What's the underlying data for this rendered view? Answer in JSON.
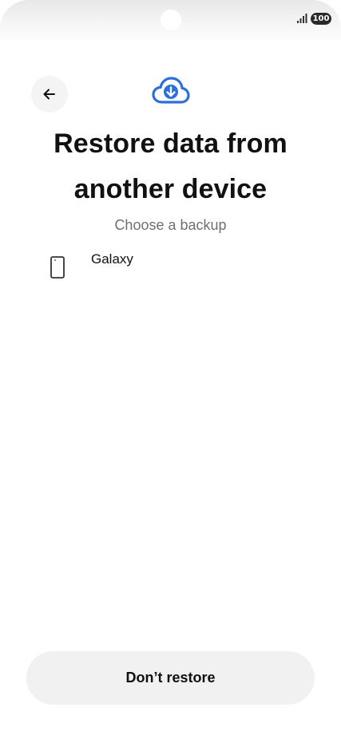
{
  "status_bar": {
    "battery": "100",
    "signal_icon": "signal-bars-icon"
  },
  "header": {
    "back_icon": "arrow-left-icon",
    "hero_icon": "cloud-download-icon"
  },
  "main": {
    "title": "Restore data from another device",
    "subtitle": "Choose a backup",
    "backups": [
      {
        "icon": "phone-icon",
        "label": "Galaxy"
      }
    ]
  },
  "footer": {
    "dont_restore_label": "Don’t restore"
  },
  "colors": {
    "accent": "#2a6fdb",
    "button_bg": "#f1f1f1",
    "subtitle": "#6f6f6f"
  }
}
